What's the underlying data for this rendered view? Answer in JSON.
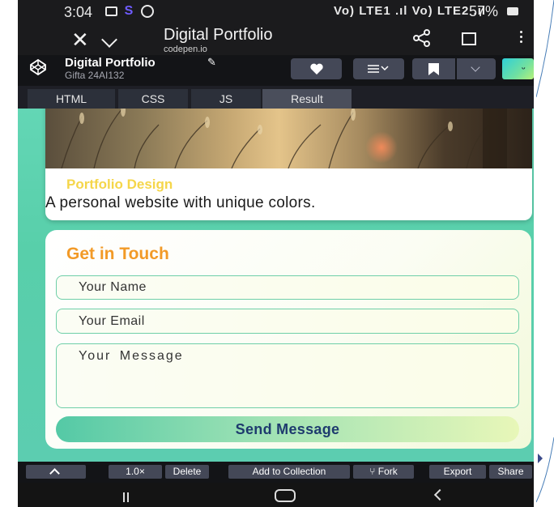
{
  "status_bar": {
    "time": "3:04",
    "app_letter": "S",
    "network_indicators": "Vo) LTE1 .ıl Vo) LTE2 .ıl",
    "battery": "57%"
  },
  "browser": {
    "title": "Digital Portfolio",
    "host": "codepen.io"
  },
  "codepen": {
    "pen_title": "Digital Portfolio",
    "author": "Gifta 24AI132",
    "tabs": [
      {
        "label": "HTML"
      },
      {
        "label": "CSS"
      },
      {
        "label": "JS"
      },
      {
        "label": "Result"
      }
    ],
    "active_tab": "Result"
  },
  "result": {
    "project_card": {
      "title": "Portfolio Design",
      "description": "A personal website with unique colors."
    },
    "contact": {
      "title": "Get in Touch",
      "name_placeholder": "Your Name",
      "email_placeholder": "Your Email",
      "message_placeholder": "Your Message",
      "send_label": "Send Message"
    }
  },
  "bottom_bar": {
    "zoom": "1.0×",
    "delete": "Delete",
    "add_collection": "Add to Collection",
    "fork": "Fork",
    "export": "Export",
    "share": "Share"
  },
  "colors": {
    "accent_orange": "#f29a27",
    "card_title_yellow": "#f5d64a",
    "result_bg_green": "#5ccdb0",
    "send_text_blue": "#1e3b6e"
  }
}
